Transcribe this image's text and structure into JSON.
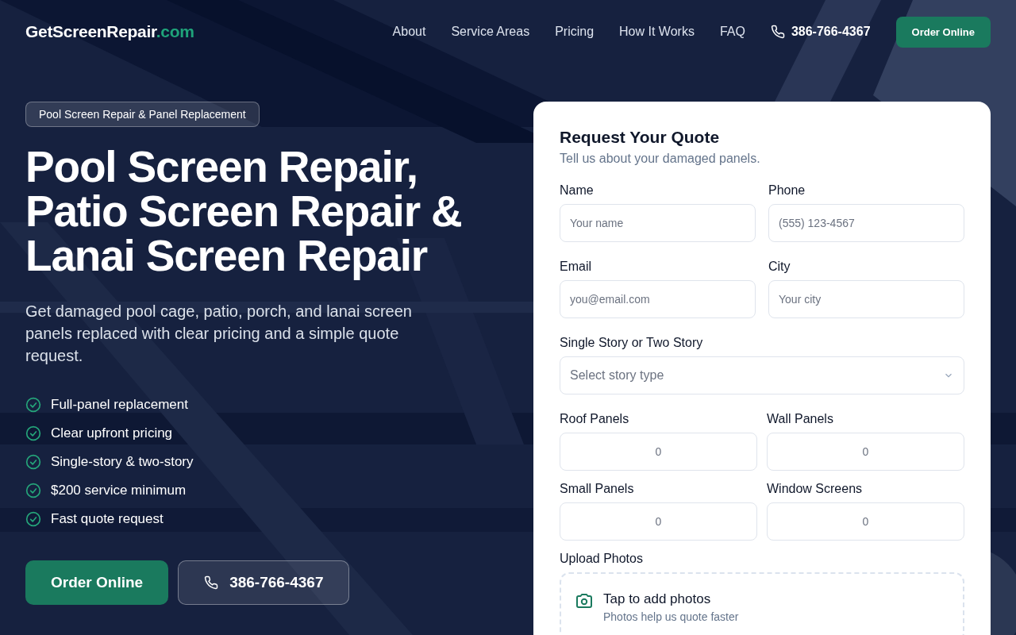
{
  "header": {
    "logo_main": "GetScreenRepair",
    "logo_suffix": ".com",
    "nav": [
      "About",
      "Service Areas",
      "Pricing",
      "How It Works",
      "FAQ"
    ],
    "phone": "386-766-4367",
    "cta": "Order Online"
  },
  "hero": {
    "badge": "Pool Screen Repair & Panel Replacement",
    "title_lines": [
      "Pool Screen Repair,",
      "Patio Screen Repair &",
      "Lanai Screen Repair"
    ],
    "subtitle": "Get damaged pool cage, patio, porch, and lanai screen panels replaced with clear pricing and a simple quote request.",
    "features": [
      "Full-panel replacement",
      "Clear upfront pricing",
      "Single-story & two-story",
      "$200 service minimum",
      "Fast quote request"
    ],
    "buttons": [
      {
        "kind": "primary",
        "label": "Order Online"
      },
      {
        "kind": "phone",
        "label": "386-766-4367"
      }
    ]
  },
  "quote_form": {
    "title": "Request Your Quote",
    "subtitle": "Tell us about your damaged panels.",
    "rows": [
      {
        "fields": [
          {
            "kind": "text",
            "label": "Name",
            "placeholder": "Your name"
          },
          {
            "kind": "text",
            "label": "Phone",
            "placeholder": "(555) 123-4567"
          }
        ]
      },
      {
        "fields": [
          {
            "kind": "text",
            "label": "Email",
            "placeholder": "you@email.com"
          },
          {
            "kind": "text",
            "label": "City",
            "placeholder": "Your city"
          }
        ]
      },
      {
        "fields": [
          {
            "kind": "select",
            "label": "Single Story or Two Story",
            "placeholder": "Select story type"
          }
        ]
      },
      {
        "fields": [
          {
            "kind": "number",
            "label": "Roof Panels",
            "placeholder": "0"
          },
          {
            "kind": "number",
            "label": "Wall Panels",
            "placeholder": "0"
          }
        ]
      },
      {
        "fields": [
          {
            "kind": "number",
            "label": "Small Panels",
            "placeholder": "0"
          },
          {
            "kind": "number",
            "label": "Window Screens",
            "placeholder": "0"
          }
        ]
      }
    ],
    "upload": {
      "label": "Upload Photos",
      "title": "Tap to add photos",
      "hint": "Photos help us quote faster"
    }
  }
}
